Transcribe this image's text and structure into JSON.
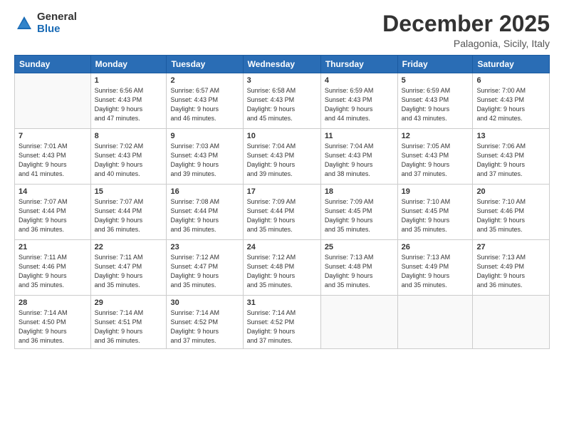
{
  "logo": {
    "general": "General",
    "blue": "Blue"
  },
  "title": "December 2025",
  "subtitle": "Palagonia, Sicily, Italy",
  "weekdays": [
    "Sunday",
    "Monday",
    "Tuesday",
    "Wednesday",
    "Thursday",
    "Friday",
    "Saturday"
  ],
  "weeks": [
    [
      {
        "day": "",
        "info": ""
      },
      {
        "day": "1",
        "info": "Sunrise: 6:56 AM\nSunset: 4:43 PM\nDaylight: 9 hours\nand 47 minutes."
      },
      {
        "day": "2",
        "info": "Sunrise: 6:57 AM\nSunset: 4:43 PM\nDaylight: 9 hours\nand 46 minutes."
      },
      {
        "day": "3",
        "info": "Sunrise: 6:58 AM\nSunset: 4:43 PM\nDaylight: 9 hours\nand 45 minutes."
      },
      {
        "day": "4",
        "info": "Sunrise: 6:59 AM\nSunset: 4:43 PM\nDaylight: 9 hours\nand 44 minutes."
      },
      {
        "day": "5",
        "info": "Sunrise: 6:59 AM\nSunset: 4:43 PM\nDaylight: 9 hours\nand 43 minutes."
      },
      {
        "day": "6",
        "info": "Sunrise: 7:00 AM\nSunset: 4:43 PM\nDaylight: 9 hours\nand 42 minutes."
      }
    ],
    [
      {
        "day": "7",
        "info": "Sunrise: 7:01 AM\nSunset: 4:43 PM\nDaylight: 9 hours\nand 41 minutes."
      },
      {
        "day": "8",
        "info": "Sunrise: 7:02 AM\nSunset: 4:43 PM\nDaylight: 9 hours\nand 40 minutes."
      },
      {
        "day": "9",
        "info": "Sunrise: 7:03 AM\nSunset: 4:43 PM\nDaylight: 9 hours\nand 39 minutes."
      },
      {
        "day": "10",
        "info": "Sunrise: 7:04 AM\nSunset: 4:43 PM\nDaylight: 9 hours\nand 39 minutes."
      },
      {
        "day": "11",
        "info": "Sunrise: 7:04 AM\nSunset: 4:43 PM\nDaylight: 9 hours\nand 38 minutes."
      },
      {
        "day": "12",
        "info": "Sunrise: 7:05 AM\nSunset: 4:43 PM\nDaylight: 9 hours\nand 37 minutes."
      },
      {
        "day": "13",
        "info": "Sunrise: 7:06 AM\nSunset: 4:43 PM\nDaylight: 9 hours\nand 37 minutes."
      }
    ],
    [
      {
        "day": "14",
        "info": "Sunrise: 7:07 AM\nSunset: 4:44 PM\nDaylight: 9 hours\nand 36 minutes."
      },
      {
        "day": "15",
        "info": "Sunrise: 7:07 AM\nSunset: 4:44 PM\nDaylight: 9 hours\nand 36 minutes."
      },
      {
        "day": "16",
        "info": "Sunrise: 7:08 AM\nSunset: 4:44 PM\nDaylight: 9 hours\nand 36 minutes."
      },
      {
        "day": "17",
        "info": "Sunrise: 7:09 AM\nSunset: 4:44 PM\nDaylight: 9 hours\nand 35 minutes."
      },
      {
        "day": "18",
        "info": "Sunrise: 7:09 AM\nSunset: 4:45 PM\nDaylight: 9 hours\nand 35 minutes."
      },
      {
        "day": "19",
        "info": "Sunrise: 7:10 AM\nSunset: 4:45 PM\nDaylight: 9 hours\nand 35 minutes."
      },
      {
        "day": "20",
        "info": "Sunrise: 7:10 AM\nSunset: 4:46 PM\nDaylight: 9 hours\nand 35 minutes."
      }
    ],
    [
      {
        "day": "21",
        "info": "Sunrise: 7:11 AM\nSunset: 4:46 PM\nDaylight: 9 hours\nand 35 minutes."
      },
      {
        "day": "22",
        "info": "Sunrise: 7:11 AM\nSunset: 4:47 PM\nDaylight: 9 hours\nand 35 minutes."
      },
      {
        "day": "23",
        "info": "Sunrise: 7:12 AM\nSunset: 4:47 PM\nDaylight: 9 hours\nand 35 minutes."
      },
      {
        "day": "24",
        "info": "Sunrise: 7:12 AM\nSunset: 4:48 PM\nDaylight: 9 hours\nand 35 minutes."
      },
      {
        "day": "25",
        "info": "Sunrise: 7:13 AM\nSunset: 4:48 PM\nDaylight: 9 hours\nand 35 minutes."
      },
      {
        "day": "26",
        "info": "Sunrise: 7:13 AM\nSunset: 4:49 PM\nDaylight: 9 hours\nand 35 minutes."
      },
      {
        "day": "27",
        "info": "Sunrise: 7:13 AM\nSunset: 4:49 PM\nDaylight: 9 hours\nand 36 minutes."
      }
    ],
    [
      {
        "day": "28",
        "info": "Sunrise: 7:14 AM\nSunset: 4:50 PM\nDaylight: 9 hours\nand 36 minutes."
      },
      {
        "day": "29",
        "info": "Sunrise: 7:14 AM\nSunset: 4:51 PM\nDaylight: 9 hours\nand 36 minutes."
      },
      {
        "day": "30",
        "info": "Sunrise: 7:14 AM\nSunset: 4:52 PM\nDaylight: 9 hours\nand 37 minutes."
      },
      {
        "day": "31",
        "info": "Sunrise: 7:14 AM\nSunset: 4:52 PM\nDaylight: 9 hours\nand 37 minutes."
      },
      {
        "day": "",
        "info": ""
      },
      {
        "day": "",
        "info": ""
      },
      {
        "day": "",
        "info": ""
      }
    ]
  ]
}
